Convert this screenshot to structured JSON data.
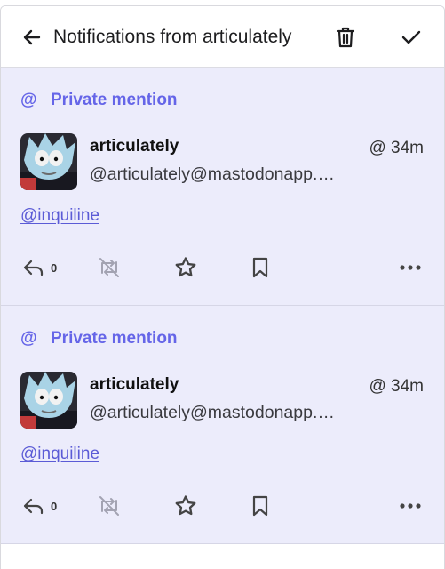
{
  "header": {
    "title": "Notifications from articulately",
    "back_icon": "arrow-left-icon",
    "delete_icon": "trash-icon",
    "done_icon": "check-icon"
  },
  "notifications": [
    {
      "label": "Private mention",
      "display_name": "articulately",
      "handle": "@articulately@mastodonapp.…",
      "visibility_symbol": "@",
      "time": "34m",
      "mention_link": "@inquiline",
      "reply_count": "0"
    },
    {
      "label": "Private mention",
      "display_name": "articulately",
      "handle": "@articulately@mastodonapp.…",
      "visibility_symbol": "@",
      "time": "34m",
      "mention_link": "@inquiline",
      "reply_count": "0"
    }
  ],
  "colors": {
    "accent": "#6565e8",
    "card_bg": "#ececfb",
    "link": "#5b5bd6"
  }
}
